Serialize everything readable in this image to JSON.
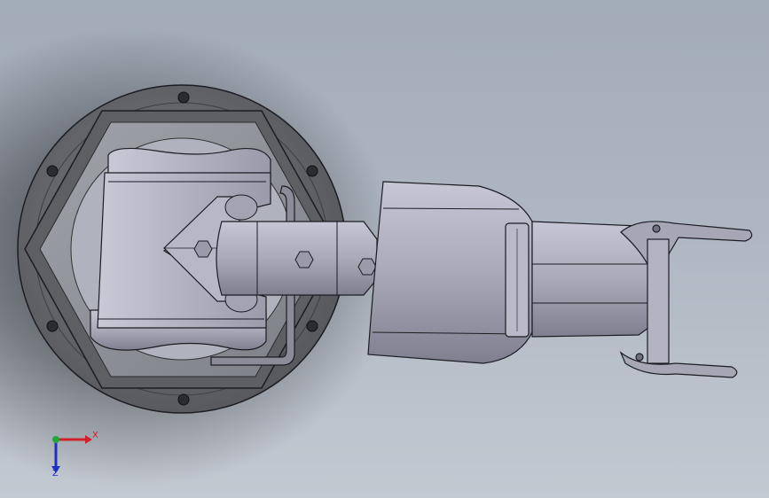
{
  "viewport": {
    "background_top": "#a2abb7",
    "background_bottom": "#c3c9d1"
  },
  "model": {
    "base_color": "#66686c",
    "part_color": "#a9a9b8",
    "edge_color": "#1c1c22"
  },
  "triad": {
    "x_label": "X",
    "z_label": "Z",
    "x_color": "#d0202a",
    "y_color": "#22a83a",
    "z_color": "#1f2fbf"
  }
}
